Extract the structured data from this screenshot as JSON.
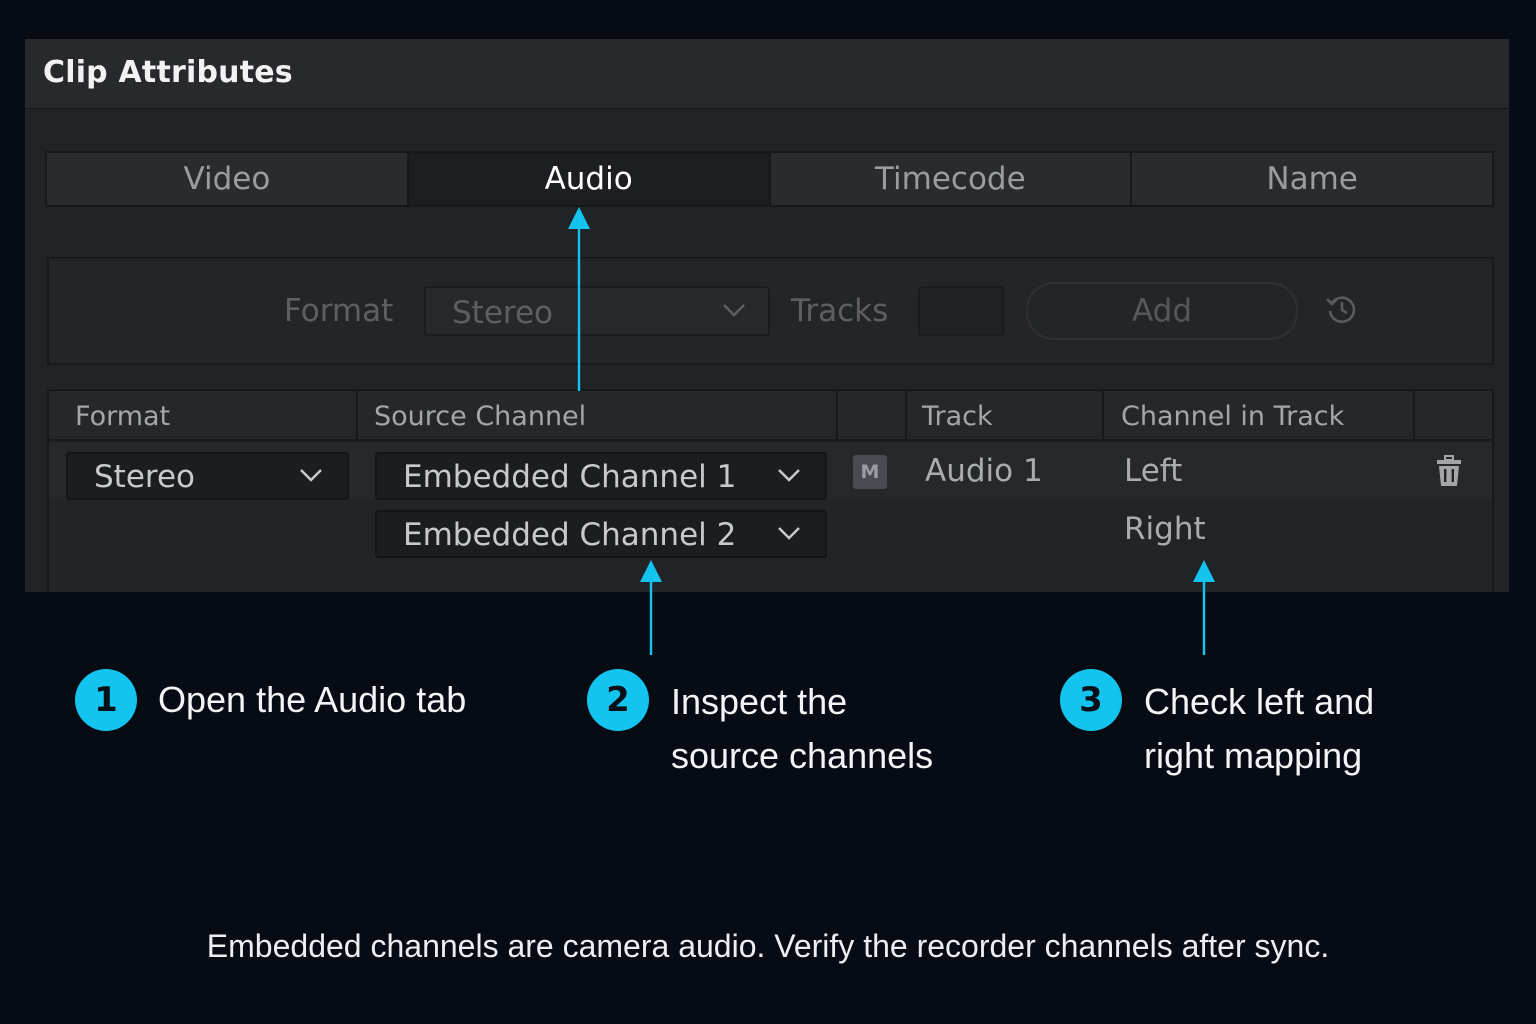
{
  "panel": {
    "title": "Clip Attributes"
  },
  "tabs": [
    {
      "label": "Video",
      "active": false
    },
    {
      "label": "Audio",
      "active": true
    },
    {
      "label": "Timecode",
      "active": false
    },
    {
      "label": "Name",
      "active": false
    }
  ],
  "format_bar": {
    "format_label": "Format",
    "format_value": "Stereo",
    "tracks_label": "Tracks",
    "tracks_value": "",
    "add_label": "Add",
    "reset_icon": "reset-history-icon"
  },
  "table": {
    "headers": [
      "Format",
      "Source Channel",
      "",
      "Track",
      "Channel in Track",
      ""
    ],
    "row": {
      "format": "Stereo",
      "source_channels": [
        "Embedded Channel 1",
        "Embedded Channel 2"
      ],
      "mute_badge": "M",
      "track": "Audio 1",
      "channels_in_track": [
        "Left",
        "Right"
      ],
      "delete_icon": "trash-icon"
    }
  },
  "steps": [
    {
      "number": "1",
      "line1": "Open the Audio tab",
      "line2": ""
    },
    {
      "number": "2",
      "line1": "Inspect the",
      "line2": "source channels"
    },
    {
      "number": "3",
      "line1": "Check left and",
      "line2": "right mapping"
    }
  ],
  "footnote": "Embedded channels are camera audio. Verify the recorder channels after sync.",
  "colors": {
    "accent": "#13c5ee",
    "background": "#070b13",
    "panel": "#222327"
  }
}
